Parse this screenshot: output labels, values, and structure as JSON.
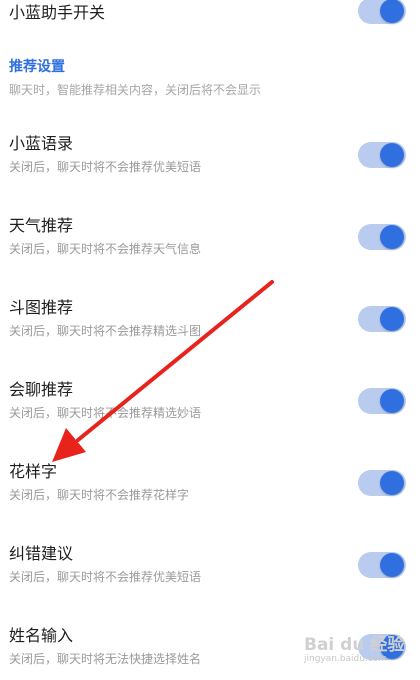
{
  "top_item": {
    "title": "小蓝助手开关",
    "enabled": true
  },
  "section": {
    "title": "推荐设置",
    "description": "聊天时，智能推荐相关内容，关闭后将不会显示"
  },
  "items": [
    {
      "title": "小蓝语录",
      "description": "关闭后，聊天时将不会推荐优美短语",
      "enabled": true
    },
    {
      "title": "天气推荐",
      "description": "关闭后，聊天时将不会推荐天气信息",
      "enabled": true
    },
    {
      "title": "斗图推荐",
      "description": "关闭后，聊天时将不会推荐精选斗图",
      "enabled": true
    },
    {
      "title": "会聊推荐",
      "description": "关闭后，聊天时将不会推荐精选妙语",
      "enabled": true
    },
    {
      "title": "花样字",
      "description": "关闭后，聊天时将不会推荐花样字",
      "enabled": true
    },
    {
      "title": "纠错建议",
      "description": "关闭后，聊天时将不会推荐优美短语",
      "enabled": true
    },
    {
      "title": "姓名输入",
      "description": "关闭后，聊天时将无法快捷选择姓名",
      "enabled": true
    }
  ],
  "watermark": {
    "brand": "Bai du 经验",
    "sub": "jingyan.baidu.com"
  },
  "colors": {
    "accent": "#2f6fe0",
    "track": "#b9ccef",
    "annotation_arrow": "#e8231b"
  }
}
